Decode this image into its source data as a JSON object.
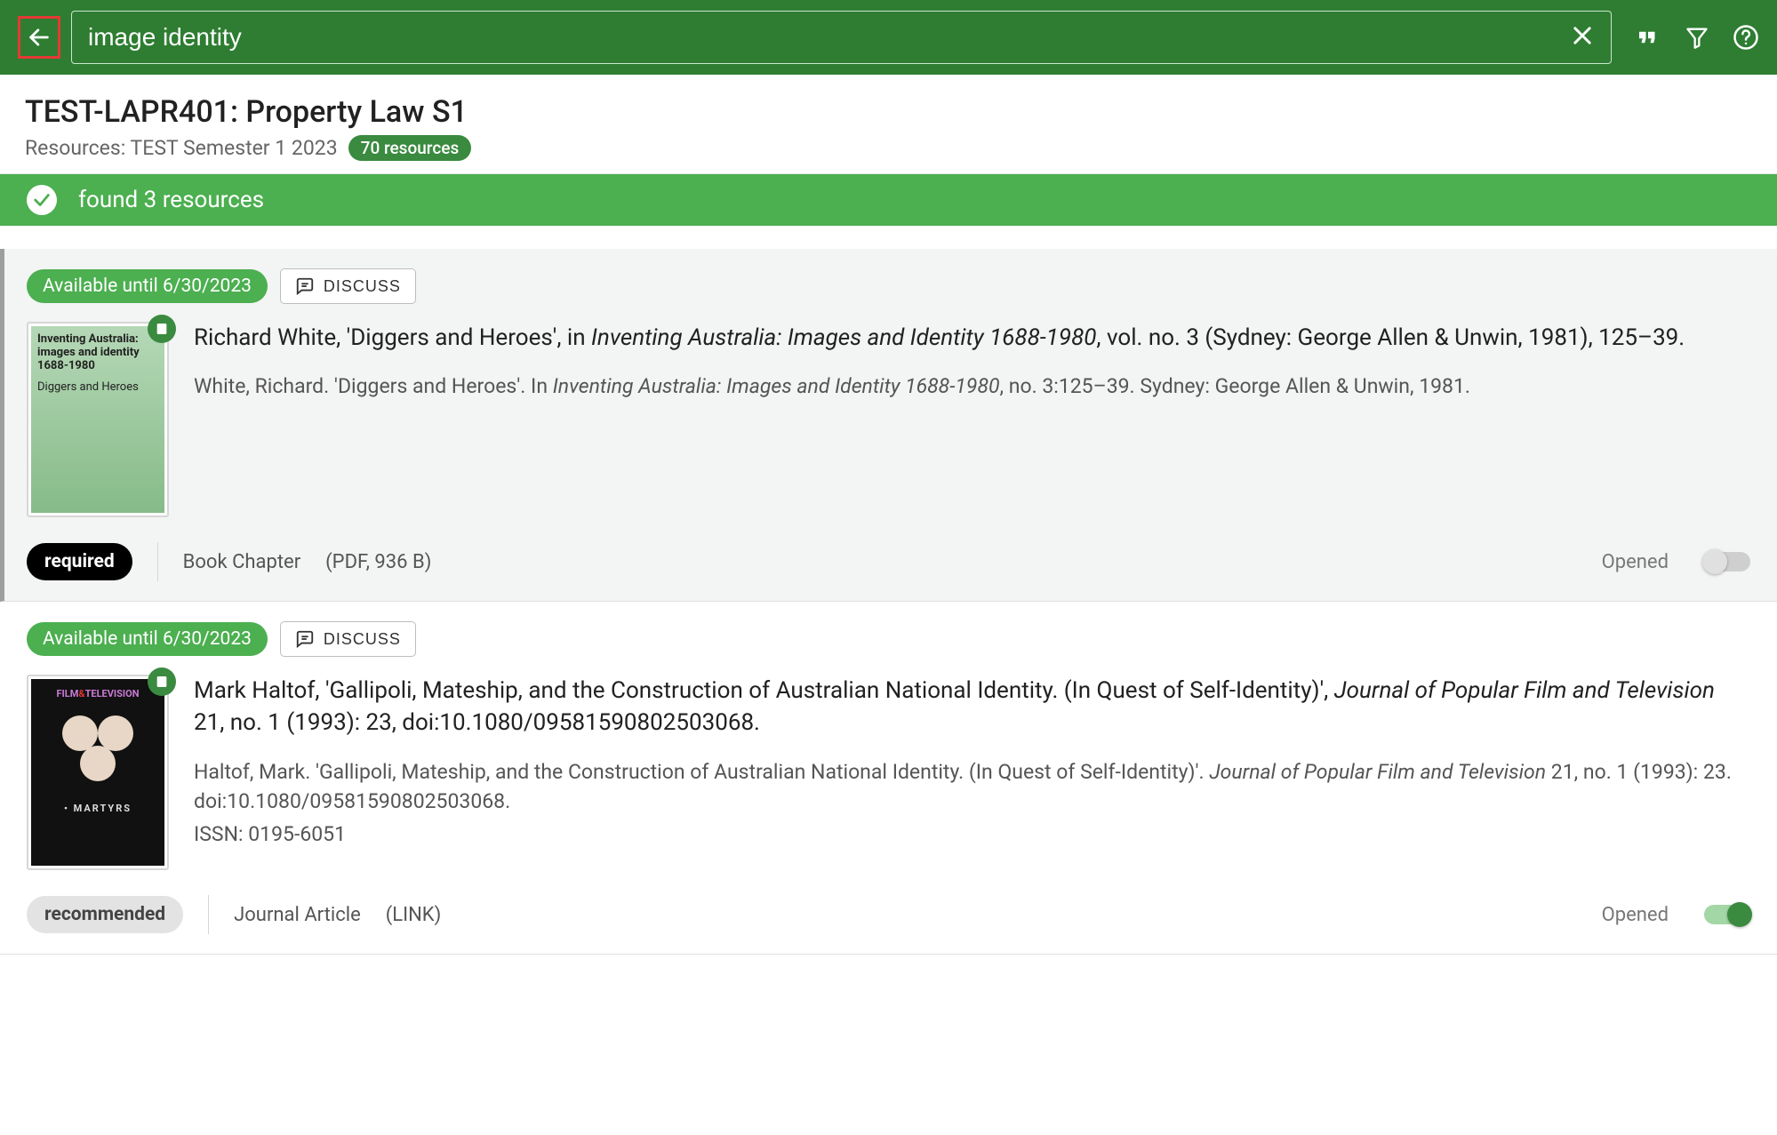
{
  "search": {
    "value": "image identity",
    "placeholder": "Search"
  },
  "toolbar": {
    "quote_tip": "Citation",
    "filter_tip": "Filter",
    "help_tip": "Help"
  },
  "course": {
    "title": "TEST-LAPR401: Property Law S1",
    "resources_line": "Resources: TEST Semester 1 2023",
    "count_badge": "70 resources"
  },
  "found_bar": {
    "text": "found 3 resources"
  },
  "labels": {
    "discuss": "DISCUSS",
    "opened": "Opened"
  },
  "results": [
    {
      "available": "Available until 6/30/2023",
      "cover_kind": "green",
      "cover_line1": "Inventing Australia: images and identity 1688-1980",
      "cover_line2": "Diggers and Heroes",
      "citation_main_pre": "Richard White, 'Diggers and Heroes', in ",
      "citation_main_ital": "Inventing Australia: Images and Identity 1688-1980",
      "citation_main_post": ", vol. no. 3 (Sydney: George Allen & Unwin, 1981), 125–39.",
      "citation_alt_pre": "White, Richard. 'Diggers and Heroes'. In ",
      "citation_alt_ital": "Inventing Australia: Images and Identity 1688-1980",
      "citation_alt_post": ", no. 3:125–39. Sydney: George Allen & Unwin, 1981.",
      "citation_alt2": "",
      "tag_label": "required",
      "tag_style": "required",
      "meta_type": "Book Chapter",
      "meta_extra": "(PDF, 936 B)",
      "opened": false
    },
    {
      "available": "Available until 6/30/2023",
      "cover_kind": "dark",
      "cover_line1": "",
      "cover_line2": "",
      "citation_main_pre": "Mark Haltof, 'Gallipoli, Mateship, and the Construction of Australian National Identity. (In Quest of Self-Identity)', ",
      "citation_main_ital": "Journal of Popular Film and Television",
      "citation_main_post": " 21, no. 1 (1993): 23, doi:10.1080/09581590802503068.",
      "citation_alt_pre": "Haltof, Mark. 'Gallipoli, Mateship, and the Construction of Australian National Identity. (In Quest of Self-Identity)'. ",
      "citation_alt_ital": "Journal of Popular Film and Television",
      "citation_alt_post": " 21, no. 1 (1993): 23. doi:10.1080/09581590802503068.",
      "citation_alt2": "ISSN: 0195-6051",
      "tag_label": "recommended",
      "tag_style": "recommended",
      "meta_type": "Journal Article",
      "meta_extra": "(LINK)",
      "opened": true
    }
  ]
}
